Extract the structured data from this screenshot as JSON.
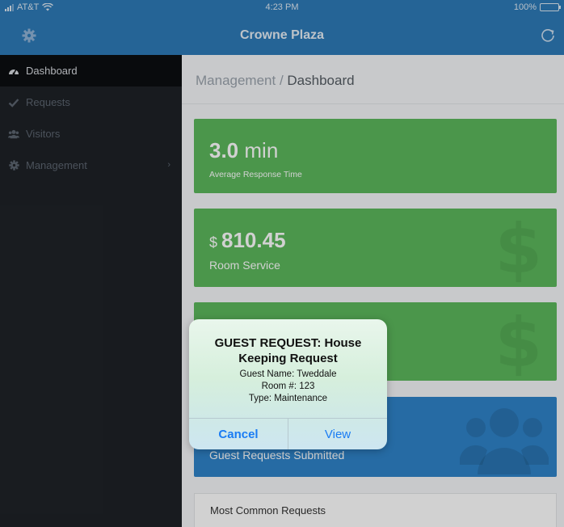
{
  "status_bar": {
    "carrier": "AT&T",
    "time": "4:23 PM",
    "battery": "100%"
  },
  "nav": {
    "title": "Crowne Plaza",
    "left_icon": "gear-icon",
    "right_icon": "refresh-icon"
  },
  "sidebar": {
    "items": [
      {
        "label": "Dashboard",
        "icon": "dashboard-icon"
      },
      {
        "label": "Requests",
        "icon": "check-icon"
      },
      {
        "label": "Visitors",
        "icon": "users-icon"
      },
      {
        "label": "Management",
        "icon": "gear-icon"
      }
    ]
  },
  "breadcrumb": {
    "parent": "Management",
    "separator": " / ",
    "current": "Dashboard"
  },
  "cards": {
    "response": {
      "value": "3.0",
      "unit": " min",
      "label": "Average Response Time"
    },
    "room_service": {
      "currency": "$ ",
      "value": "810.45",
      "label": "Room Service"
    },
    "guest_requests": {
      "label": "Guest Requests Submitted"
    }
  },
  "panel": {
    "title": "Most Common Requests"
  },
  "dialog": {
    "title": "GUEST REQUEST: House Keeping Request",
    "guest_name": "Guest Name: Tweddale",
    "room": "Room #: 123",
    "type": "Type: Maintenance",
    "cancel_label": "Cancel",
    "view_label": "View"
  },
  "colors": {
    "nav_blue": "#2e7bb8",
    "card_green": "#5cb85c",
    "card_blue": "#2f83c8",
    "sidebar_dark": "#1e2227",
    "ios_link": "#1a7cf4"
  }
}
